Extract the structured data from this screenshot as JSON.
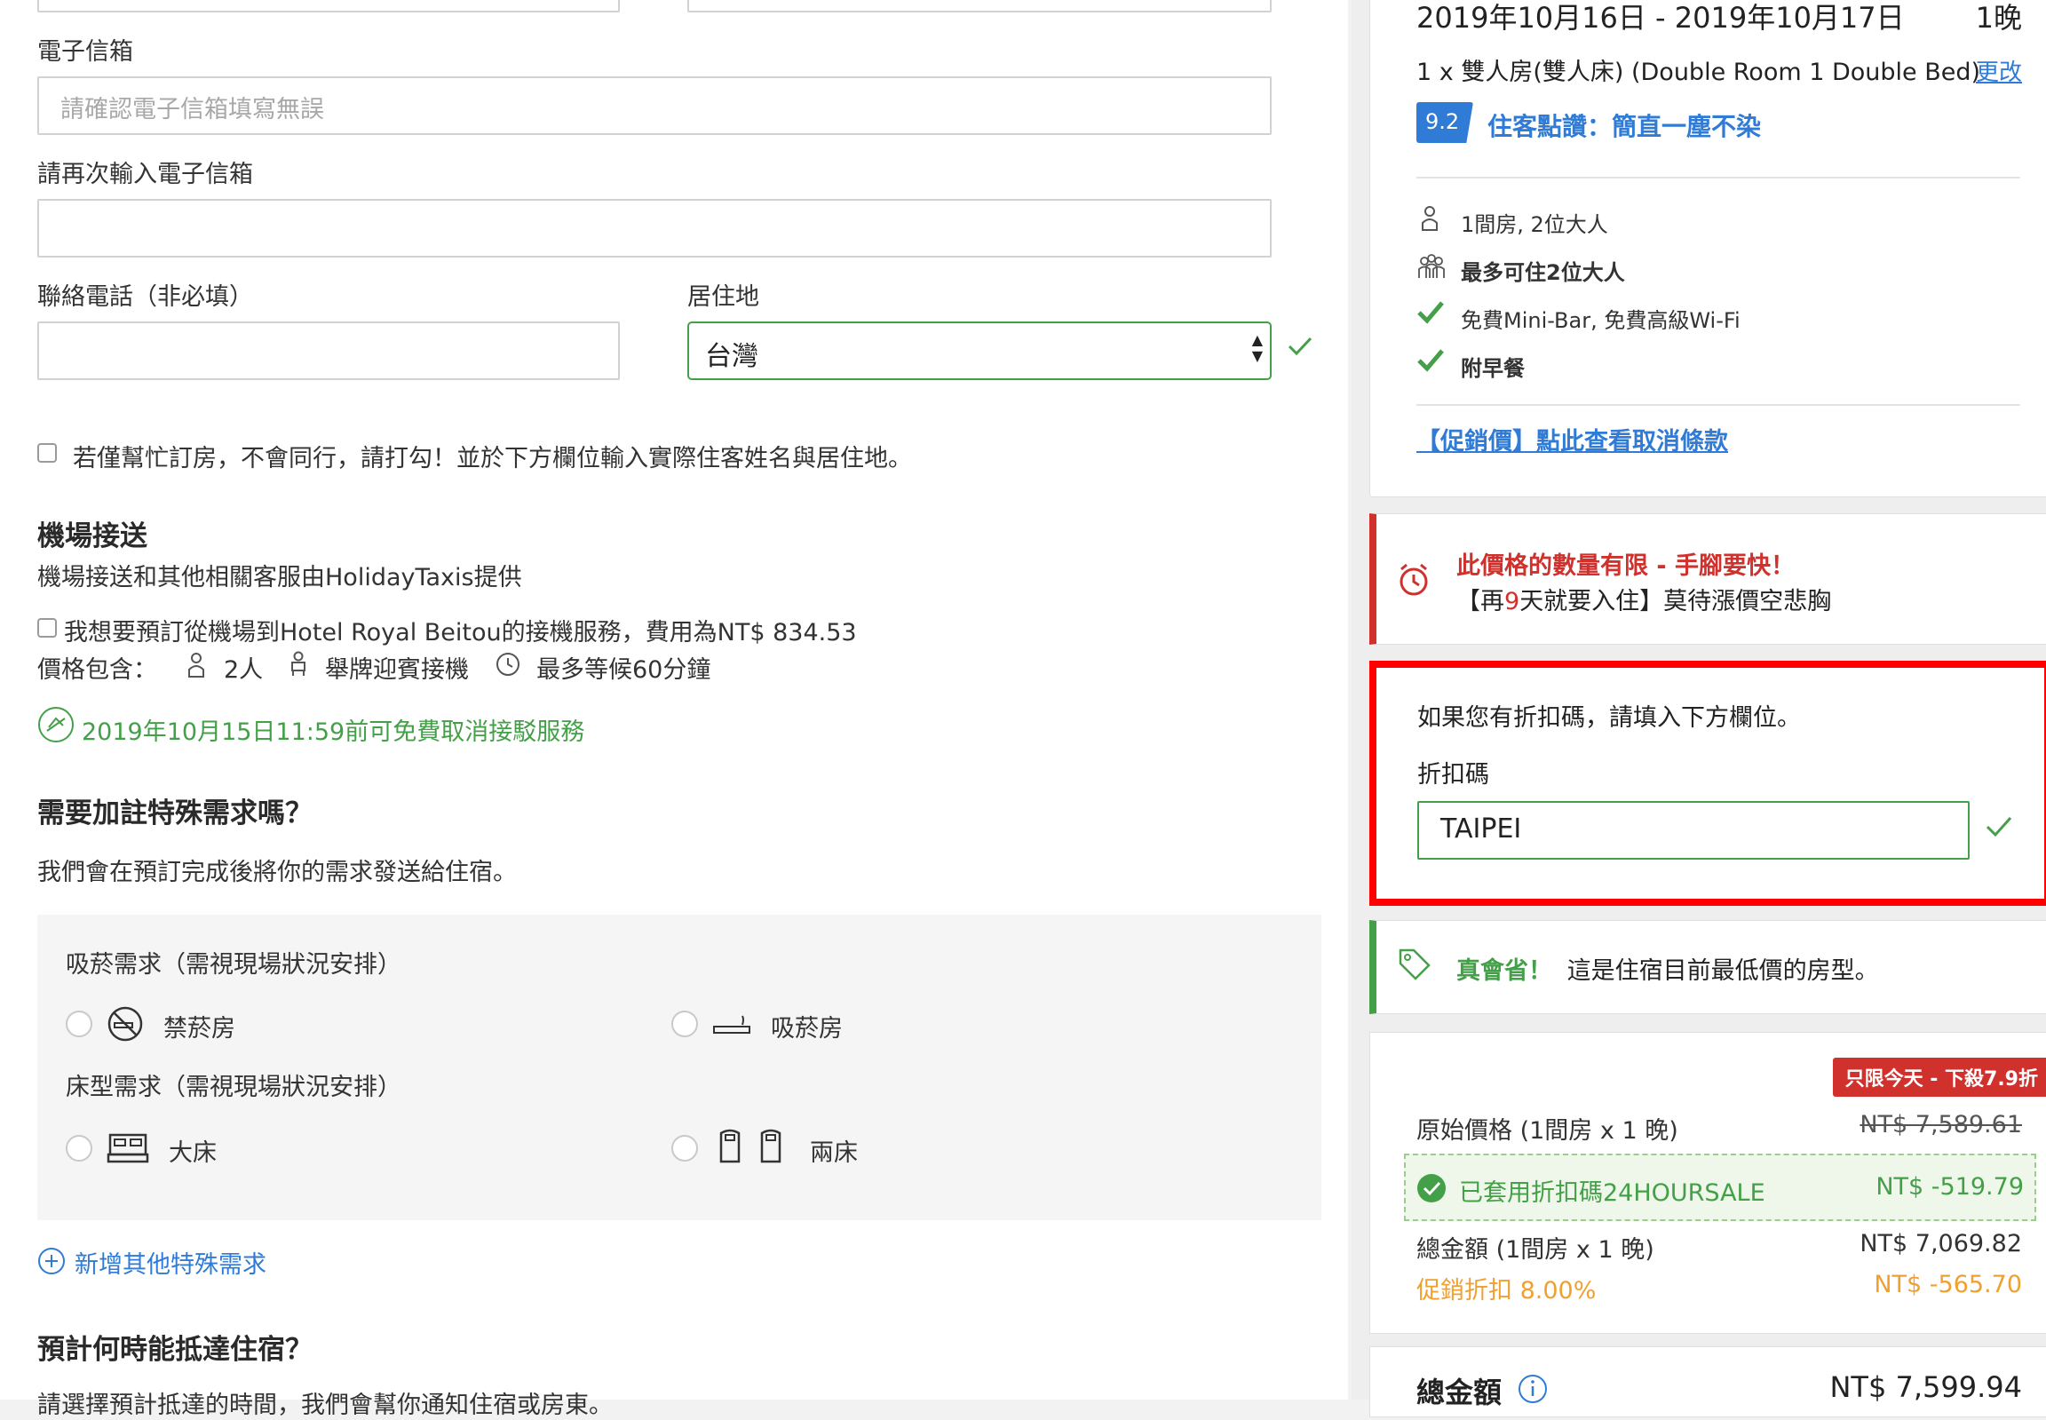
{
  "form": {
    "email_label": "電子信箱",
    "email_placeholder": "請確認電子信箱填寫無誤",
    "email_confirm_label": "請再次輸入電子信箱",
    "phone_label": "聯絡電話（非必填）",
    "residence_label": "居住地",
    "residence_value": "台灣",
    "proxy_checkbox_label": "若僅幫忙訂房，不會同行，請打勾！並於下方欄位輸入實際住客姓名與居住地。"
  },
  "airport": {
    "title": "機場接送",
    "provider": "機場接送和其他相關客服由HolidayTaxis提供",
    "checkbox_label": "我想要預訂從機場到Hotel Royal Beitou的接機服務，費用為NT$ 834.53",
    "includes_label": "價格包含：",
    "includes": [
      "2人",
      "舉牌迎賓接機",
      "最多等候60分鐘"
    ],
    "free_cancel": "2019年10月15日11:59前可免費取消接駁服務"
  },
  "special": {
    "title": "需要加註特殊需求嗎？",
    "desc": "我們會在預訂完成後將你的需求發送給住宿。",
    "smoking_title": "吸菸需求（需視現場狀況安排）",
    "non_smoking": "禁菸房",
    "smoking": "吸菸房",
    "bed_title": "床型需求（需視現場狀況安排）",
    "big_bed": "大床",
    "twin_bed": "兩床",
    "add_more": "新增其他特殊需求"
  },
  "arrival": {
    "title": "預計何時能抵達住宿？",
    "desc_partial": "請選擇預計抵達的時間，我們會幫你通知住宿或房東。"
  },
  "summary": {
    "dates": "2019年10月16日 - 2019年10月17日",
    "nights": "1晚",
    "room": "1 x 雙人房(雙人床) (Double Room 1 Double Bed)",
    "change_link": "更改",
    "score": "9.2",
    "score_text": "住客點讚：簡直一塵不染",
    "rooms_guests": "1間房, 2位大人",
    "max_guests": "最多可住2位大人",
    "amenity": "免費Mini-Bar, 免費高級Wi-Fi",
    "breakfast": "附早餐",
    "cancel_link": "【促銷價】點此查看取消條款"
  },
  "urgency": {
    "title": "此價格的數量有限 - 手腳要快！",
    "text_prefix": "【再",
    "days": "9",
    "text_suffix": "天就要入住】莫待漲價空悲胸"
  },
  "promo": {
    "intro": "如果您有折扣碼，請填入下方欄位。",
    "label": "折扣碼",
    "value": "TAIPEI"
  },
  "deal": {
    "highlight": "真會省！",
    "text": "這是住宿目前最低價的房型。"
  },
  "pricing": {
    "badge": "只限今天 - 下殺7.9折",
    "original_label": "原始價格 (1間房 x 1 晚)",
    "original_value": "NT$ 7,589.61",
    "coupon_label": "已套用折扣碼24HOURSALE",
    "coupon_value": "NT$ -519.79",
    "subtotal_label": "總金額 (1間房 x 1 晚)",
    "subtotal_value": "NT$ 7,069.82",
    "promo_label": "促銷折扣 8.00%",
    "promo_value": "NT$ -565.70",
    "total_label": "總金額",
    "total_value": "NT$ 7,599.94"
  },
  "colors": {
    "accent_blue": "#2f7bd5",
    "success_green": "#44a048",
    "alert_red": "#d0312d",
    "promo_orange": "#f0a030",
    "highlight_border": "#ff0000"
  }
}
